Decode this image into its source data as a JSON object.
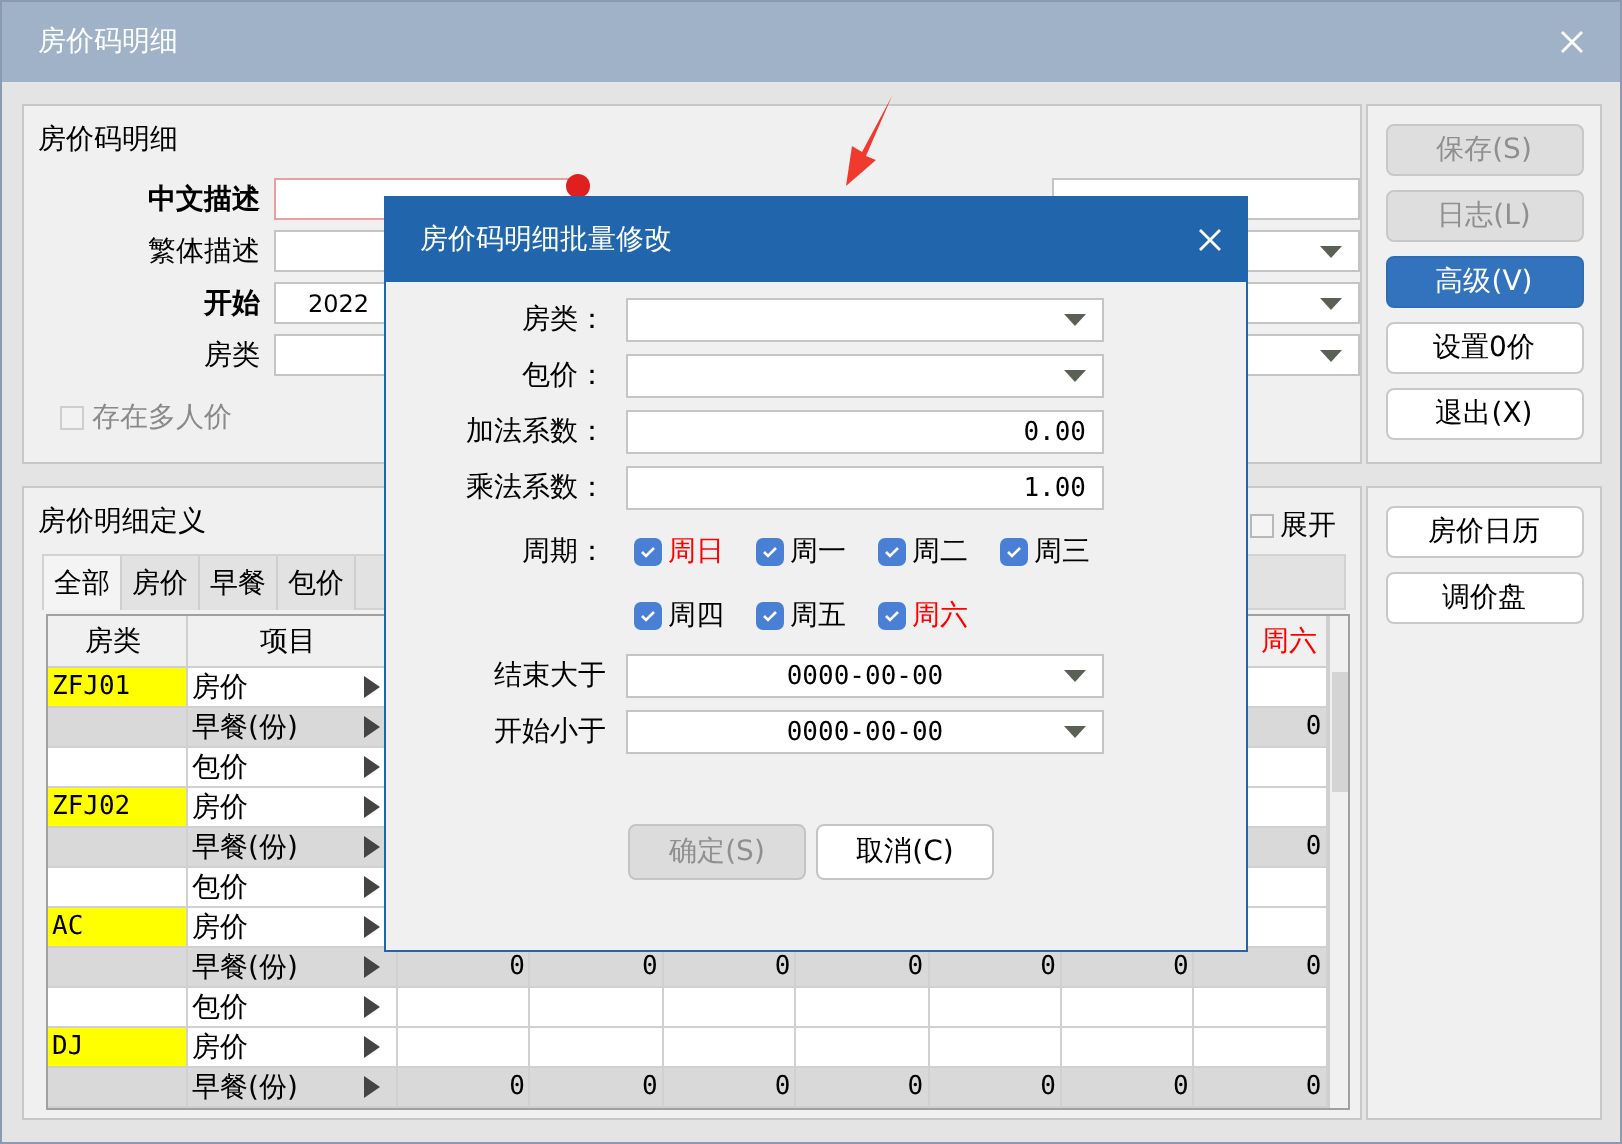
{
  "window": {
    "title": "房价码明细"
  },
  "header": {
    "title": "房价码明细",
    "fields": [
      {
        "label": "中文描述",
        "bold": true,
        "error": true
      },
      {
        "label": "繁体描述",
        "bold": false,
        "error": false
      },
      {
        "label": "开始",
        "bold": true,
        "error": false,
        "value": "2022"
      },
      {
        "label": "房类",
        "bold": false,
        "error": false
      }
    ],
    "right_fields": [
      {
        "kind": "text"
      },
      {
        "kind": "dropdown"
      },
      {
        "kind": "dropdown"
      },
      {
        "kind": "dropdown"
      }
    ],
    "multi_person": {
      "label": "存在多人价",
      "checked": false,
      "disabled": true
    }
  },
  "actions": [
    {
      "label": "保存(S)",
      "disabled": true,
      "selected": false
    },
    {
      "label": "日志(L)",
      "disabled": true,
      "selected": false
    },
    {
      "label": "高级(V)",
      "disabled": false,
      "selected": true
    },
    {
      "label": "设置0价",
      "disabled": false,
      "selected": false
    },
    {
      "label": "退出(X)",
      "disabled": false,
      "selected": false
    }
  ],
  "detail": {
    "title": "房价明细定义",
    "expand": {
      "label": "展开",
      "checked": false
    },
    "tabs": [
      {
        "label": "全部",
        "selected": true
      },
      {
        "label": "房价",
        "selected": false
      },
      {
        "label": "早餐",
        "selected": false
      },
      {
        "label": "包价",
        "selected": false
      }
    ],
    "table": {
      "columns": [
        {
          "label": "房类",
          "weekend": false
        },
        {
          "label": "项目",
          "weekend": false
        },
        {
          "label": "周六",
          "weekend": true
        }
      ],
      "rows": [
        {
          "room_type": "ZFJ01",
          "item": "房价",
          "kind": "price"
        },
        {
          "item": "早餐(份)",
          "kind": "breakfast",
          "values": [
            "0"
          ]
        },
        {
          "item": "包价",
          "kind": "package"
        },
        {
          "room_type": "ZFJ02",
          "item": "房价",
          "kind": "price"
        },
        {
          "item": "早餐(份)",
          "kind": "breakfast",
          "values": [
            "0"
          ]
        },
        {
          "item": "包价",
          "kind": "package"
        },
        {
          "room_type": "AC",
          "item": "房价",
          "kind": "price"
        },
        {
          "item": "早餐(份)",
          "kind": "breakfast",
          "values": [
            "0",
            "0",
            "0",
            "0",
            "0",
            "0",
            "0"
          ]
        },
        {
          "item": "包价",
          "kind": "package"
        },
        {
          "room_type": "DJ",
          "item": "房价",
          "kind": "price"
        },
        {
          "item": "早餐(份)",
          "kind": "breakfast",
          "values": [
            "0",
            "0",
            "0",
            "0",
            "0",
            "0",
            "0"
          ]
        }
      ]
    }
  },
  "side_buttons": [
    {
      "label": "房价日历"
    },
    {
      "label": "调价盘"
    }
  ],
  "dialog": {
    "title": "房价码明细批量修改",
    "fields": [
      {
        "label": "房类：",
        "kind": "dropdown"
      },
      {
        "label": "包价：",
        "kind": "dropdown"
      },
      {
        "label": "加法系数：",
        "kind": "number",
        "value": "0.00"
      },
      {
        "label": "乘法系数：",
        "kind": "number",
        "value": "1.00"
      }
    ],
    "period_label": "周期：",
    "days": [
      {
        "label": "周日",
        "checked": true,
        "weekend": true
      },
      {
        "label": "周一",
        "checked": true,
        "weekend": false
      },
      {
        "label": "周二",
        "checked": true,
        "weekend": false
      },
      {
        "label": "周三",
        "checked": true,
        "weekend": false
      },
      {
        "label": "周四",
        "checked": true,
        "weekend": false
      },
      {
        "label": "周五",
        "checked": true,
        "weekend": false
      },
      {
        "label": "周六",
        "checked": true,
        "weekend": true
      }
    ],
    "date_fields": [
      {
        "label": "结束大于",
        "value": "0000-00-00"
      },
      {
        "label": "开始小于",
        "value": "0000-00-00"
      }
    ],
    "buttons": [
      {
        "label": "确定(S)",
        "disabled": true
      },
      {
        "label": "取消(C)",
        "disabled": false
      }
    ]
  }
}
